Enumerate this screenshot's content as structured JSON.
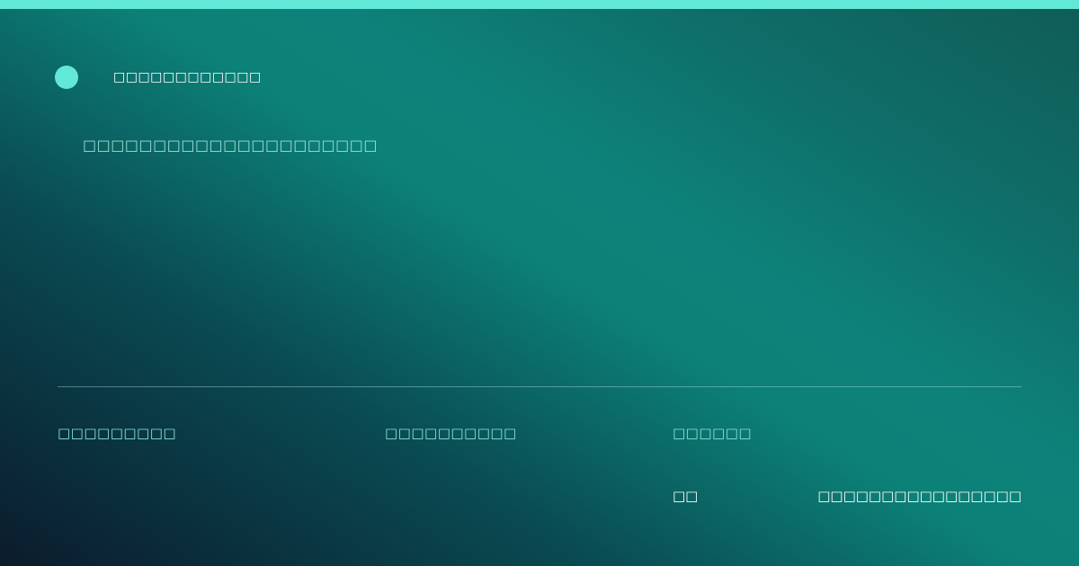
{
  "colors": {
    "accent": "#62e8d6",
    "background_dark": "#0b1b2c",
    "background_teal": "#0d827a",
    "label_text": "#86e3d6",
    "headline_text": "#9edfd6",
    "primary_text": "#ffffff"
  },
  "brand": {
    "icon": "status-dot-icon",
    "name": "□□□□□□□□□□□□"
  },
  "headline": "□□□□□□□□□□□□□□□□□□□□□",
  "footer": {
    "labels": [
      "□□□□□□□□□",
      "□□□□□□□□□□",
      "□□□□□□"
    ],
    "meta_key": "□□",
    "meta_value": "□□□□□□□□□□□□□□□□"
  }
}
